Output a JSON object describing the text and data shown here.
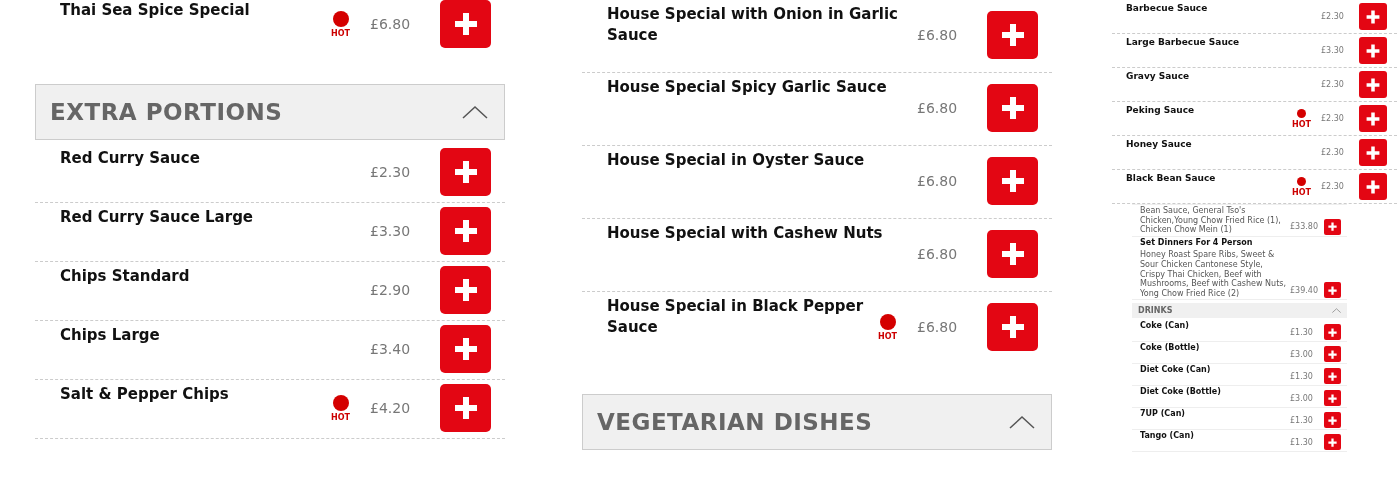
{
  "columns": [
    {
      "blocks": [
        {
          "kind": "item",
          "name": "Thai Sea Spice Special",
          "badge": "HOT",
          "price": "£6.80"
        },
        {
          "kind": "header",
          "title": "EXTRA PORTIONS",
          "expanded": true
        },
        {
          "kind": "item",
          "name": "Red Curry Sauce",
          "price": "£2.30"
        },
        {
          "kind": "item",
          "name": "Red Curry Sauce Large",
          "price": "£3.30"
        },
        {
          "kind": "item",
          "name": "Chips Standard",
          "price": "£2.90"
        },
        {
          "kind": "item",
          "name": "Chips Large",
          "price": "£3.40"
        },
        {
          "kind": "item",
          "name": "Salt & Pepper Chips",
          "badge": "HOT",
          "price": "£4.20"
        }
      ]
    },
    {
      "blocks": [
        {
          "kind": "item",
          "name": "House Special with Onion in Garlic Sauce",
          "price": "£6.80"
        },
        {
          "kind": "item",
          "name": "House Special Spicy Garlic Sauce",
          "price": "£6.80"
        },
        {
          "kind": "item",
          "name": "House Special in Oyster Sauce",
          "price": "£6.80"
        },
        {
          "kind": "item",
          "name": "House Special with Cashew Nuts",
          "price": "£6.80"
        },
        {
          "kind": "item",
          "name": "House Special in Black Pepper Sauce",
          "badge": "HOT",
          "price": "£6.80"
        },
        {
          "kind": "header",
          "title": "VEGETARIAN DISHES",
          "expanded": true
        }
      ]
    },
    {
      "blocks": [
        {
          "kind": "item",
          "name": "Barbecue Sauce",
          "price": "£2.30"
        },
        {
          "kind": "item",
          "name": "Large Barbecue Sauce",
          "price": "£3.30"
        },
        {
          "kind": "item",
          "name": "Gravy Sauce",
          "price": "£2.30"
        },
        {
          "kind": "item",
          "name": "Peking Sauce",
          "badge": "HOT",
          "price": "£2.30"
        },
        {
          "kind": "item",
          "name": "Honey Sauce",
          "price": "£2.30"
        },
        {
          "kind": "item",
          "name": "Black Bean Sauce",
          "badge": "HOT",
          "price": "£2.30"
        },
        {
          "kind": "inset",
          "blocks": [
            {
              "kind": "item",
              "description": "Bean Sauce, General Tso's Chicken,Young Chow Fried Rice (1), Chicken Chow Mein (1)",
              "price": "£33.80"
            },
            {
              "kind": "item",
              "name": "Set Dinners For 4 Person",
              "description": "Honey Roast Spare Ribs, Sweet & Sour Chicken Cantonese Style, Crispy Thai Chicken, Beef with Mushrooms, Beef with Cashew Nuts, Yong Chow Fried Rice (2)",
              "price": "£39.40"
            },
            {
              "kind": "header",
              "title": "DRINKS",
              "expanded": true
            },
            {
              "kind": "item",
              "name": "Coke (Can)",
              "price": "£1.30"
            },
            {
              "kind": "item",
              "name": "Coke (Bottle)",
              "price": "£3.00"
            },
            {
              "kind": "item",
              "name": "Diet Coke (Can)",
              "price": "£1.30"
            },
            {
              "kind": "item",
              "name": "Diet Coke (Bottle)",
              "price": "£3.00"
            },
            {
              "kind": "item",
              "name": "7UP (Can)",
              "price": "£1.30"
            },
            {
              "kind": "item",
              "name": "Tango (Can)",
              "price": "£1.30"
            }
          ]
        }
      ]
    }
  ]
}
